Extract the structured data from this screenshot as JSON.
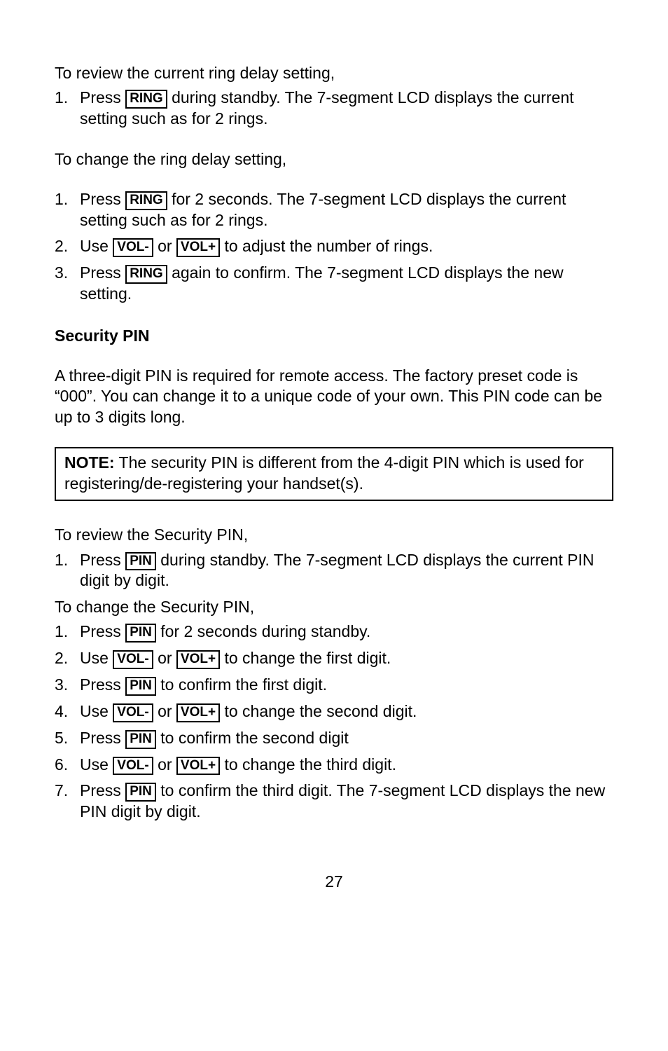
{
  "pageNumber": "27",
  "keys": {
    "ring": "RING",
    "volMinus": "VOL-",
    "volPlus": "VOL+",
    "pin": "PIN"
  },
  "review": {
    "intro": "To review the current ring delay setting,",
    "step1_a": "Press ",
    "step1_b": " during standby. The 7-segment LCD displays the current setting such as      for 2 rings."
  },
  "change": {
    "intro": "To change the ring delay setting,",
    "step1_a": "Press ",
    "step1_b": "for 2 seconds. The 7-segment LCD displays the current setting such as      for 2 rings.",
    "step2_a": "Use ",
    "step2_b": "or ",
    "step2_c": "to adjust the number of rings.",
    "step3_a": "Press ",
    "step3_b": "again to confirm. The 7-segment LCD displays the new setting."
  },
  "security": {
    "heading": "Security PIN",
    "paragraph": "A three-digit PIN is required for remote access. The factory preset code is “000”. You can change it to a unique code of your own. This PIN code can be up to 3 digits long.",
    "noteLabel": "NOTE:",
    "noteText": " The security PIN is different from the 4-digit PIN which is used for registering/de-registering your handset(s).",
    "reviewIntro": "To review the Security PIN,",
    "review1_a": "Press",
    "review1_b": " during standby. The 7-segment LCD displays the current PIN digit by digit.",
    "changeIntro": "To change the Security PIN,",
    "c1_a": "Press",
    "c1_b": "for 2 seconds during standby.",
    "c2_a": "Use",
    "c2_b": " or ",
    "c2_c": "to change the first digit.",
    "c3_a": "Press",
    "c3_b": "to confirm the first digit.",
    "c4_a": "Use",
    "c4_b": "or ",
    "c4_c": " to change the second digit.",
    "c5_a": "Press ",
    "c5_b": " to confirm the second digit",
    "c6_a": "Use ",
    "c6_b": "or ",
    "c6_c": "to change the third digit.",
    "c7_a": "Press ",
    "c7_b": " to confirm the third digit. The 7-segment LCD displays the new PIN digit by digit."
  }
}
